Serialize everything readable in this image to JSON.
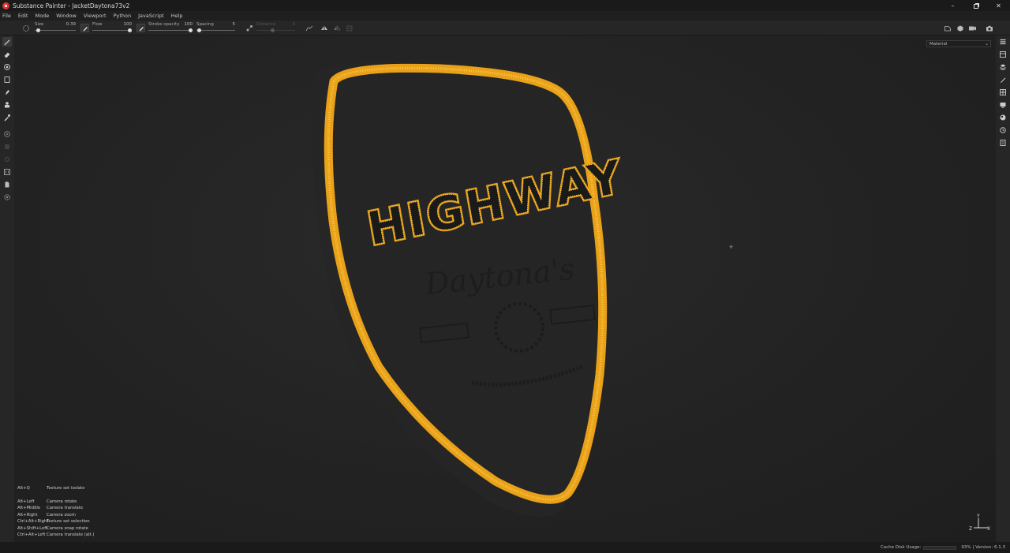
{
  "window": {
    "title": "Substance Painter - JacketDaytona73v2",
    "controls": [
      "minimize",
      "restore",
      "close"
    ]
  },
  "menu": [
    "File",
    "Edit",
    "Mode",
    "Window",
    "Viewport",
    "Python",
    "JavaScript",
    "Help"
  ],
  "tool_properties": {
    "size": {
      "label": "Size",
      "value": "0.39",
      "level": 0.05
    },
    "flow": {
      "label": "Flow",
      "value": "100",
      "level": 1.0
    },
    "stroke_opacity": {
      "label": "Stroke opacity",
      "value": "100",
      "level": 1.0
    },
    "spacing": {
      "label": "Spacing",
      "value": "5",
      "level": 0.02
    },
    "distance": {
      "label": "Distance",
      "value": "0",
      "level": 0.4,
      "disabled": true
    }
  },
  "viewport": {
    "display_mode": "Material",
    "patch_text": "HIGHWAY",
    "patch_sub_text": "Daytona's"
  },
  "shortcuts": {
    "first": {
      "key": "Alt+Q",
      "action": "Texture set isolate"
    },
    "items": [
      {
        "key": "Alt+Left",
        "action": "Camera rotate"
      },
      {
        "key": "Alt+Middle",
        "action": "Camera translate"
      },
      {
        "key": "Alt+Right",
        "action": "Camera zoom"
      },
      {
        "key": "Ctrl+Alt+Right",
        "action": "Texture set selection"
      },
      {
        "key": "Alt+Shift+Left",
        "action": "Camera snap rotate"
      },
      {
        "key": "Ctrl+Alt+Left",
        "action": "Camera translate (alt.)"
      }
    ]
  },
  "gizmo": {
    "y": "Y",
    "z": "Z",
    "x": "X"
  },
  "status": {
    "cache_label": "Cache Disk Usage:",
    "cache_value": "93%",
    "version": "| Version: 6.1.3"
  },
  "colors": {
    "accent_yellow": "#f2a71b",
    "patch_fabric": "#242424",
    "logo_red": "#dd3333"
  },
  "icons": {
    "left": [
      "brush-icon",
      "eraser-icon",
      "projection-icon",
      "polygon-fill-icon",
      "smudge-icon",
      "clone-icon",
      "color-picker-icon",
      "bake-icon",
      "layers-icon",
      "geometry-icon",
      "uv-icon",
      "doc-icon",
      "settings-icon"
    ],
    "right": [
      "texture-set-list-icon",
      "texture-set-settings-icon",
      "layers-icon",
      "properties-icon",
      "shelf-icon",
      "display-settings-icon",
      "shader-settings-icon",
      "history-icon",
      "log-icon"
    ]
  }
}
